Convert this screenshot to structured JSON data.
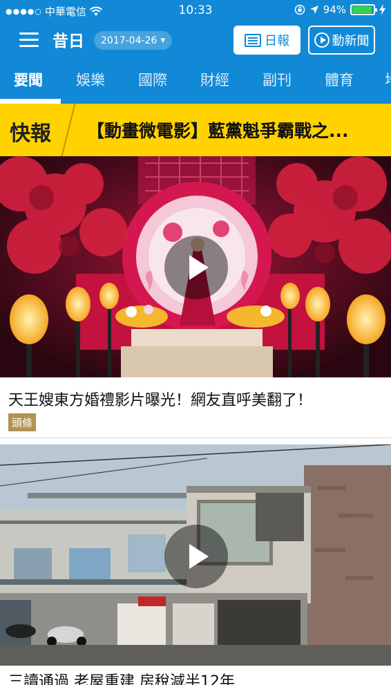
{
  "status_bar": {
    "carrier": "中華電信",
    "time": "10:33",
    "battery": "94%",
    "battery_level": 0.94
  },
  "header": {
    "brand": "昔日",
    "date": "2017-04-26",
    "daily_button": "日報",
    "video_button": "動新聞"
  },
  "tabs": [
    {
      "label": "要聞",
      "active": true
    },
    {
      "label": "娛樂",
      "active": false
    },
    {
      "label": "國際",
      "active": false
    },
    {
      "label": "財經",
      "active": false
    },
    {
      "label": "副刊",
      "active": false
    },
    {
      "label": "體育",
      "active": false
    },
    {
      "label": "地",
      "active": false
    }
  ],
  "breaking": {
    "label": "快報",
    "headline": "【動畫微電影】藍黨魁爭霸戰之..."
  },
  "articles": [
    {
      "title": "天王嫂東方婚禮影片曝光！網友直呼美翻了！",
      "badge": "頭條"
    },
    {
      "title": "三讀通過 老屋重建 房稅減半12年"
    }
  ],
  "colors": {
    "brand_blue": "#1189d6",
    "breaking_yellow": "#ffd200",
    "badge_gold": "#b39254"
  },
  "icons": [
    "menu-icon",
    "wifi-icon",
    "lock-rotation-icon",
    "location-arrow-icon",
    "battery-icon",
    "charging-bolt-icon",
    "newspaper-icon",
    "play-circle-icon",
    "play-icon"
  ]
}
